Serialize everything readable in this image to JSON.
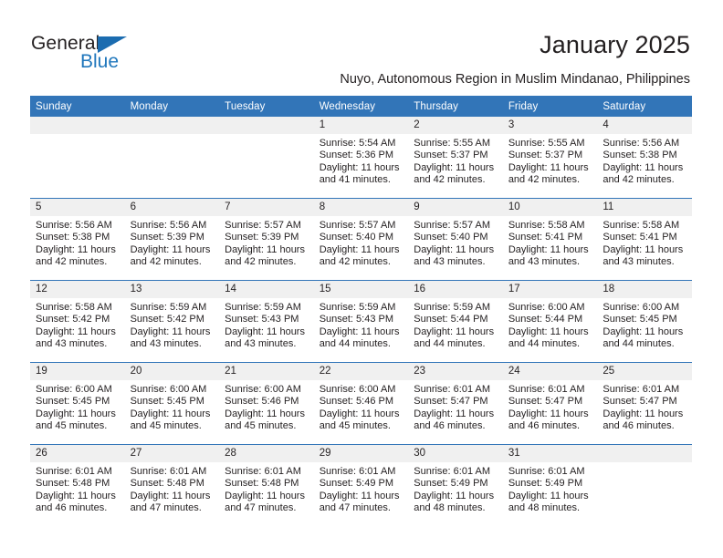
{
  "brand": {
    "name_part1": "General",
    "name_part2": "Blue",
    "accent_color": "#2077bc",
    "triangle_icon": "triangle-icon"
  },
  "header": {
    "title": "January 2025",
    "subtitle": "Nuyo, Autonomous Region in Muslim Mindanao, Philippines"
  },
  "calendar": {
    "header_bg": "#3275b8",
    "daynum_bg": "#f0f0f0",
    "weekday_headers": [
      "Sunday",
      "Monday",
      "Tuesday",
      "Wednesday",
      "Thursday",
      "Friday",
      "Saturday"
    ],
    "weeks": [
      [
        {
          "day": "",
          "empty": true
        },
        {
          "day": "",
          "empty": true
        },
        {
          "day": "",
          "empty": true
        },
        {
          "day": "1",
          "sunrise": "Sunrise: 5:54 AM",
          "sunset": "Sunset: 5:36 PM",
          "daylight": "Daylight: 11 hours and 41 minutes."
        },
        {
          "day": "2",
          "sunrise": "Sunrise: 5:55 AM",
          "sunset": "Sunset: 5:37 PM",
          "daylight": "Daylight: 11 hours and 42 minutes."
        },
        {
          "day": "3",
          "sunrise": "Sunrise: 5:55 AM",
          "sunset": "Sunset: 5:37 PM",
          "daylight": "Daylight: 11 hours and 42 minutes."
        },
        {
          "day": "4",
          "sunrise": "Sunrise: 5:56 AM",
          "sunset": "Sunset: 5:38 PM",
          "daylight": "Daylight: 11 hours and 42 minutes."
        }
      ],
      [
        {
          "day": "5",
          "sunrise": "Sunrise: 5:56 AM",
          "sunset": "Sunset: 5:38 PM",
          "daylight": "Daylight: 11 hours and 42 minutes."
        },
        {
          "day": "6",
          "sunrise": "Sunrise: 5:56 AM",
          "sunset": "Sunset: 5:39 PM",
          "daylight": "Daylight: 11 hours and 42 minutes."
        },
        {
          "day": "7",
          "sunrise": "Sunrise: 5:57 AM",
          "sunset": "Sunset: 5:39 PM",
          "daylight": "Daylight: 11 hours and 42 minutes."
        },
        {
          "day": "8",
          "sunrise": "Sunrise: 5:57 AM",
          "sunset": "Sunset: 5:40 PM",
          "daylight": "Daylight: 11 hours and 42 minutes."
        },
        {
          "day": "9",
          "sunrise": "Sunrise: 5:57 AM",
          "sunset": "Sunset: 5:40 PM",
          "daylight": "Daylight: 11 hours and 43 minutes."
        },
        {
          "day": "10",
          "sunrise": "Sunrise: 5:58 AM",
          "sunset": "Sunset: 5:41 PM",
          "daylight": "Daylight: 11 hours and 43 minutes."
        },
        {
          "day": "11",
          "sunrise": "Sunrise: 5:58 AM",
          "sunset": "Sunset: 5:41 PM",
          "daylight": "Daylight: 11 hours and 43 minutes."
        }
      ],
      [
        {
          "day": "12",
          "sunrise": "Sunrise: 5:58 AM",
          "sunset": "Sunset: 5:42 PM",
          "daylight": "Daylight: 11 hours and 43 minutes."
        },
        {
          "day": "13",
          "sunrise": "Sunrise: 5:59 AM",
          "sunset": "Sunset: 5:42 PM",
          "daylight": "Daylight: 11 hours and 43 minutes."
        },
        {
          "day": "14",
          "sunrise": "Sunrise: 5:59 AM",
          "sunset": "Sunset: 5:43 PM",
          "daylight": "Daylight: 11 hours and 43 minutes."
        },
        {
          "day": "15",
          "sunrise": "Sunrise: 5:59 AM",
          "sunset": "Sunset: 5:43 PM",
          "daylight": "Daylight: 11 hours and 44 minutes."
        },
        {
          "day": "16",
          "sunrise": "Sunrise: 5:59 AM",
          "sunset": "Sunset: 5:44 PM",
          "daylight": "Daylight: 11 hours and 44 minutes."
        },
        {
          "day": "17",
          "sunrise": "Sunrise: 6:00 AM",
          "sunset": "Sunset: 5:44 PM",
          "daylight": "Daylight: 11 hours and 44 minutes."
        },
        {
          "day": "18",
          "sunrise": "Sunrise: 6:00 AM",
          "sunset": "Sunset: 5:45 PM",
          "daylight": "Daylight: 11 hours and 44 minutes."
        }
      ],
      [
        {
          "day": "19",
          "sunrise": "Sunrise: 6:00 AM",
          "sunset": "Sunset: 5:45 PM",
          "daylight": "Daylight: 11 hours and 45 minutes."
        },
        {
          "day": "20",
          "sunrise": "Sunrise: 6:00 AM",
          "sunset": "Sunset: 5:45 PM",
          "daylight": "Daylight: 11 hours and 45 minutes."
        },
        {
          "day": "21",
          "sunrise": "Sunrise: 6:00 AM",
          "sunset": "Sunset: 5:46 PM",
          "daylight": "Daylight: 11 hours and 45 minutes."
        },
        {
          "day": "22",
          "sunrise": "Sunrise: 6:00 AM",
          "sunset": "Sunset: 5:46 PM",
          "daylight": "Daylight: 11 hours and 45 minutes."
        },
        {
          "day": "23",
          "sunrise": "Sunrise: 6:01 AM",
          "sunset": "Sunset: 5:47 PM",
          "daylight": "Daylight: 11 hours and 46 minutes."
        },
        {
          "day": "24",
          "sunrise": "Sunrise: 6:01 AM",
          "sunset": "Sunset: 5:47 PM",
          "daylight": "Daylight: 11 hours and 46 minutes."
        },
        {
          "day": "25",
          "sunrise": "Sunrise: 6:01 AM",
          "sunset": "Sunset: 5:47 PM",
          "daylight": "Daylight: 11 hours and 46 minutes."
        }
      ],
      [
        {
          "day": "26",
          "sunrise": "Sunrise: 6:01 AM",
          "sunset": "Sunset: 5:48 PM",
          "daylight": "Daylight: 11 hours and 46 minutes."
        },
        {
          "day": "27",
          "sunrise": "Sunrise: 6:01 AM",
          "sunset": "Sunset: 5:48 PM",
          "daylight": "Daylight: 11 hours and 47 minutes."
        },
        {
          "day": "28",
          "sunrise": "Sunrise: 6:01 AM",
          "sunset": "Sunset: 5:48 PM",
          "daylight": "Daylight: 11 hours and 47 minutes."
        },
        {
          "day": "29",
          "sunrise": "Sunrise: 6:01 AM",
          "sunset": "Sunset: 5:49 PM",
          "daylight": "Daylight: 11 hours and 47 minutes."
        },
        {
          "day": "30",
          "sunrise": "Sunrise: 6:01 AM",
          "sunset": "Sunset: 5:49 PM",
          "daylight": "Daylight: 11 hours and 48 minutes."
        },
        {
          "day": "31",
          "sunrise": "Sunrise: 6:01 AM",
          "sunset": "Sunset: 5:49 PM",
          "daylight": "Daylight: 11 hours and 48 minutes."
        },
        {
          "day": "",
          "empty": true
        }
      ]
    ]
  }
}
